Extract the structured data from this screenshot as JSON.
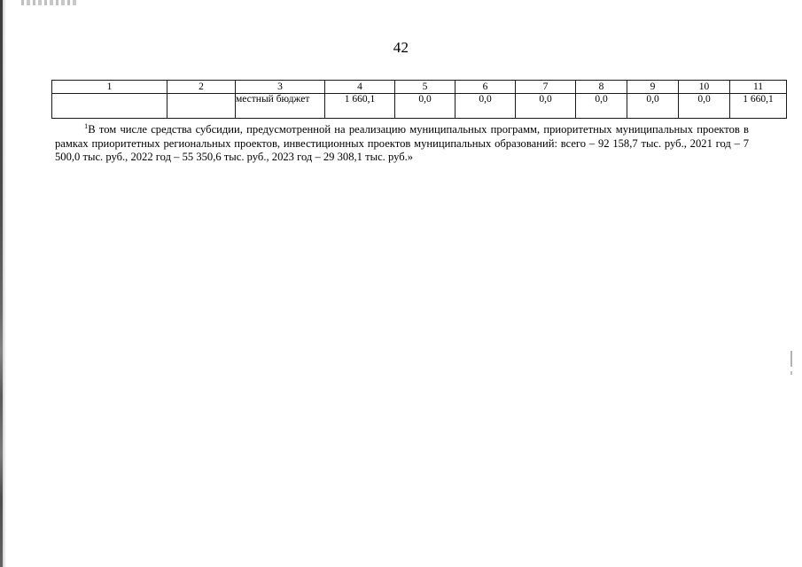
{
  "page": {
    "number": "42"
  },
  "table": {
    "headers": [
      "1",
      "2",
      "3",
      "4",
      "5",
      "6",
      "7",
      "8",
      "9",
      "10",
      "11"
    ],
    "rows": [
      {
        "cells": [
          "",
          "",
          "местный бюджет",
          "1 660,1",
          "0,0",
          "0,0",
          "0,0",
          "0,0",
          "0,0",
          "0,0",
          "1 660,1"
        ]
      }
    ]
  },
  "footnote": {
    "marker": "1",
    "text": "В том числе средства субсидии, предусмотренной на реализацию муниципальных программ, приоритетных муниципальных проектов в рамках приоритетных региональных проектов, инвестиционных проектов муниципальных образований: всего – 92 158,7 тыс. руб., 2021 год – 7 500,0 тыс. руб., 2022 год – 55 350,6 тыс. руб., 2023 год – 29 308,1 тыс. руб.»"
  }
}
